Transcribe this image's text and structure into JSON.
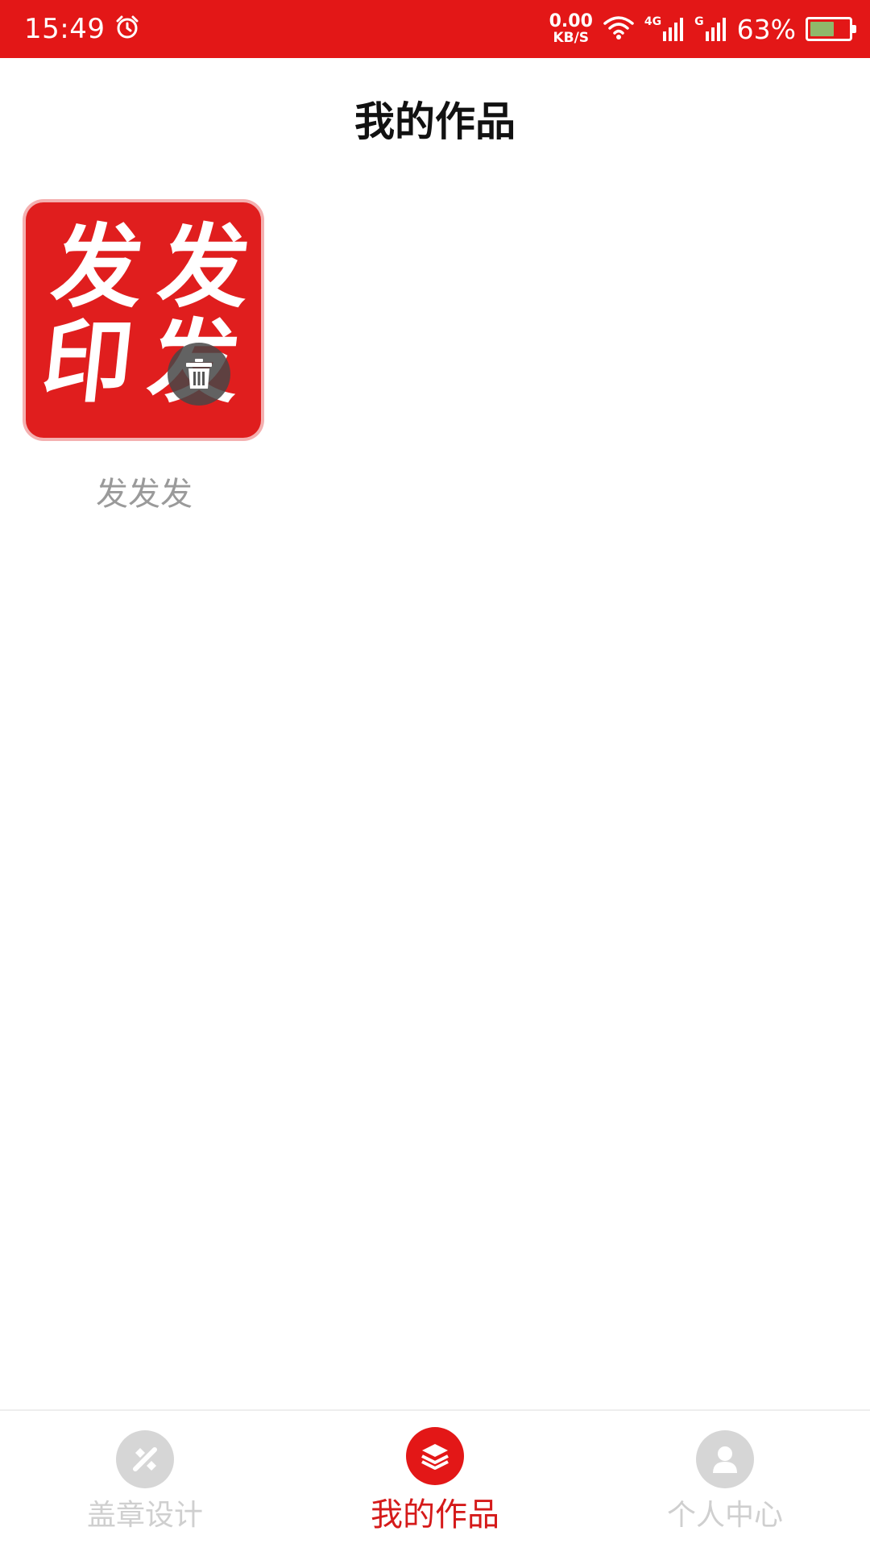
{
  "status_bar": {
    "time": "15:49",
    "net_speed_value": "0.00",
    "net_speed_unit": "KB/S",
    "signal1_label": "4G",
    "signal2_label": "G",
    "battery_text": "63%",
    "battery_level": 0.63
  },
  "header": {
    "title": "我的作品"
  },
  "works": [
    {
      "stamp_chars": [
        "发",
        "发",
        "印",
        "发"
      ],
      "label": "发发发"
    }
  ],
  "tabbar": {
    "items": [
      {
        "label": "盖章设计",
        "icon": "stamp-design-icon",
        "active": false
      },
      {
        "label": "我的作品",
        "icon": "layers-icon",
        "active": true
      },
      {
        "label": "个人中心",
        "icon": "user-icon",
        "active": false
      }
    ]
  },
  "colors": {
    "brand_red": "#e31717",
    "inactive_gray": "#cfcfcf"
  }
}
